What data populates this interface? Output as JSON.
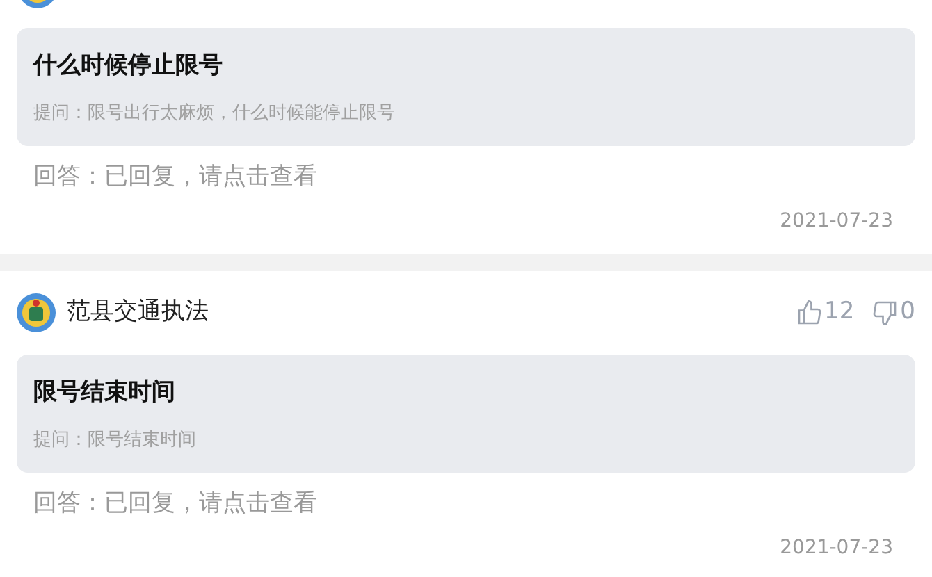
{
  "posts": [
    {
      "header_cut": true,
      "title": "什么时候停止限号",
      "question": "提问：限号出行太麻烦，什么时候能停止限号",
      "answer": "回答：已回复，请点击查看",
      "date": "2021-07-23"
    },
    {
      "header_cut": false,
      "author": "范县交通执法",
      "likes": "12",
      "dislikes": "0",
      "title": "限号结束时间",
      "question": "提问：限号结束时间",
      "answer": "回答：已回复，请点击查看",
      "date": "2021-07-23"
    }
  ]
}
